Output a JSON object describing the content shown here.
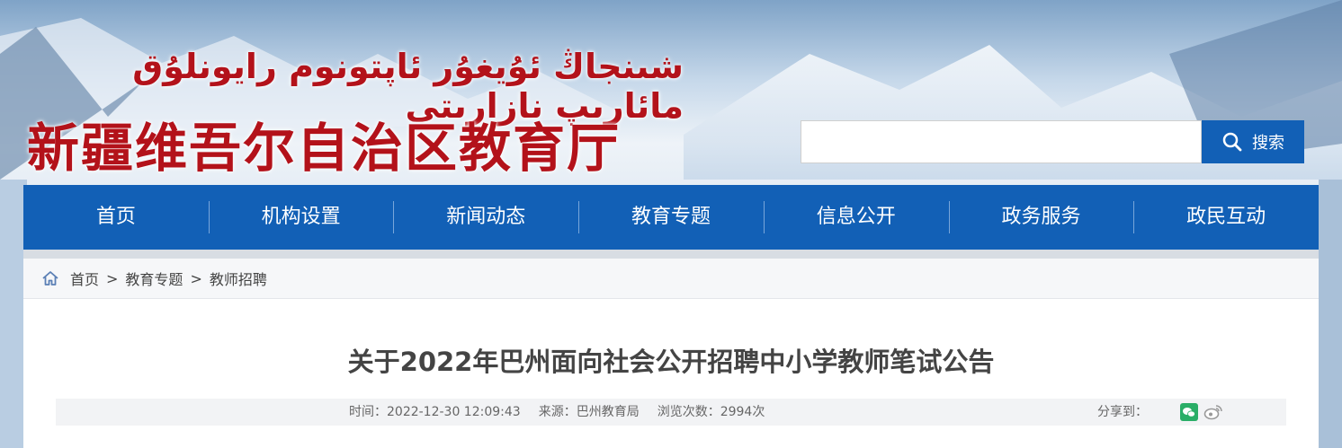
{
  "header": {
    "logo_uyghur": "شىنجاڭ ئۇيغۇر ئاپتونوم رايونلۇق مائارىپ نازارىتى",
    "logo_chinese": "新疆维吾尔自治区教育厅"
  },
  "search": {
    "placeholder": "",
    "button_label": "搜索",
    "icon": "search-icon"
  },
  "nav": {
    "items": [
      "首页",
      "机构设置",
      "新闻动态",
      "教育专题",
      "信息公开",
      "政务服务",
      "政民互动"
    ]
  },
  "breadcrumb": {
    "icon": "home-icon",
    "items": [
      "首页",
      "教育专题",
      "教师招聘"
    ],
    "separator": ">"
  },
  "article": {
    "title": "关于2022年巴州面向社会公开招聘中小学教师笔试公告",
    "time": "时间：2022-12-30 12:09:43",
    "source": "来源：巴州教育局",
    "views": "浏览次数：2994次",
    "share_label": "分享到："
  },
  "colors": {
    "nav_blue": "#1260b6",
    "logo_red": "#b3121a",
    "wechat_green": "#2aae67"
  }
}
